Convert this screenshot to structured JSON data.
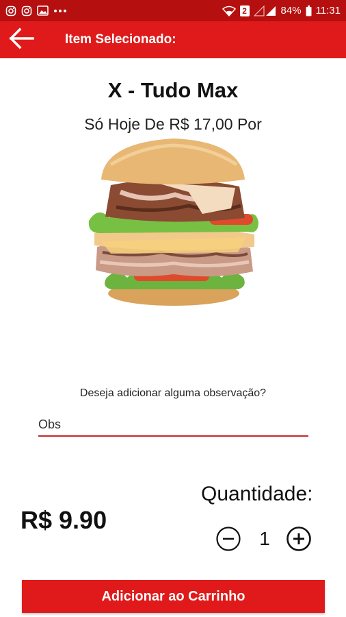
{
  "status_bar": {
    "battery": "84%",
    "time": "11:31",
    "sim_badge": "2",
    "left_icons": [
      "instagram-icon",
      "instagram-icon",
      "image-icon",
      "more-dots-icon"
    ],
    "right_icons": [
      "wifi-icon",
      "sim-icon",
      "signal-icon",
      "battery-icon"
    ]
  },
  "app_bar": {
    "title": "Item Selecionado:",
    "back_icon": "arrow-left-icon"
  },
  "product": {
    "name": "X - Tudo Max",
    "promo": "Só Hoje De R$ 17,00 Por",
    "image": "burger-image"
  },
  "observation": {
    "question": "Deseja adicionar alguma observação?",
    "placeholder": "Obs",
    "value": ""
  },
  "quantity": {
    "label": "Quantidade:",
    "value": "1",
    "minus_icon": "minus-circle-icon",
    "plus_icon": "plus-circle-icon"
  },
  "price": "R$ 9.90",
  "cart_button": "Adicionar ao Carrinho",
  "colors": {
    "status_bar": "#b50f0f",
    "primary": "#e01a1a",
    "underline": "#c62828"
  }
}
